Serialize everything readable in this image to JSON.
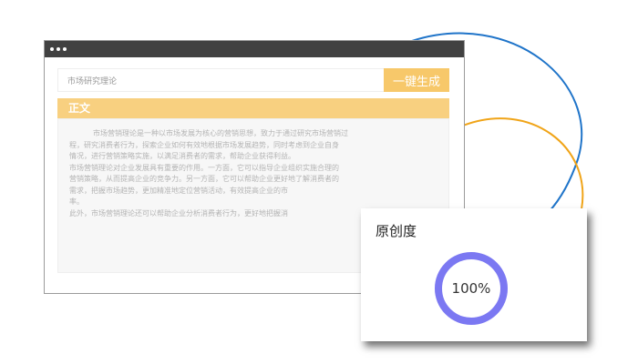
{
  "colors": {
    "accent_orange": "#f7c86a",
    "section_orange": "#f8d080",
    "ring_purple": "#7b78f2",
    "arc_blue": "#1f74c9",
    "arc_orange": "#f0a418",
    "titlebar": "#414141"
  },
  "window": {
    "input_value": "市场研究理论",
    "generate_label": "一键生成",
    "section_title": "正文",
    "content_lines": [
      "市场营销理论是一种以市场发展为核心的营销思想，致力于通过研究市场营销过",
      "程，研究消费者行为，探索企业如何有效地根据市场发展趋势，同时考虑到企业自身",
      "情况，进行营销策略实施，以满足消费者的需求，帮助企业获得利益。",
      "市场营销理论对企业发展具有重要的作用。一方面，它可以指导企业组织实施合理的",
      "营销策略，从而提高企业的竞争力。另一方面，它可以帮助企业更好地了解消费者的",
      "需求，把握市场趋势，更加精准地定位营销活动，有效提高企业的市",
      "率。",
      "此外，市场营销理论还可以帮助企业分析消费者行为，更好地把握消"
    ]
  },
  "originality": {
    "title": "原创度",
    "value_text": "100%",
    "percent": 100
  }
}
